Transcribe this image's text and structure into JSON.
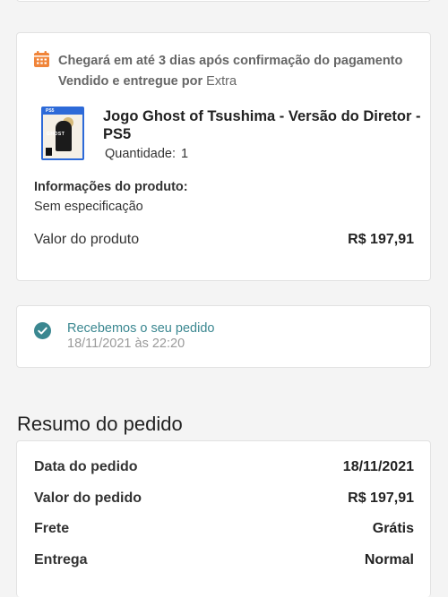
{
  "delivery": {
    "icon": "calendar-icon",
    "accent_color": "#f0853a",
    "line1": "Chegará em até 3 dias após confirmação do pagamento",
    "sold_by_label": "Vendido e entregue por",
    "seller": "Extra"
  },
  "product": {
    "thumbnail_icon": "game-cover-thumbnail",
    "name": "Jogo Ghost of Tsushima - Versão do Diretor - PS5",
    "quantity_label": "Quantidade:",
    "quantity": "1",
    "info_label": "Informações do produto:",
    "info_value": "Sem especificação",
    "value_label": "Valor do produto",
    "value_amount": "R$ 197,91"
  },
  "status": {
    "icon": "check-circle-icon",
    "color": "#3a8790",
    "text": "Recebemos o seu pedido",
    "time": "18/11/2021 às 22:20"
  },
  "summary": {
    "title": "Resumo do pedido",
    "rows": [
      {
        "label": "Data do pedido",
        "value": "18/11/2021"
      },
      {
        "label": "Valor do pedido",
        "value": "R$ 197,91"
      },
      {
        "label": "Frete",
        "value": "Grátis"
      },
      {
        "label": "Entrega",
        "value": "Normal"
      }
    ]
  }
}
